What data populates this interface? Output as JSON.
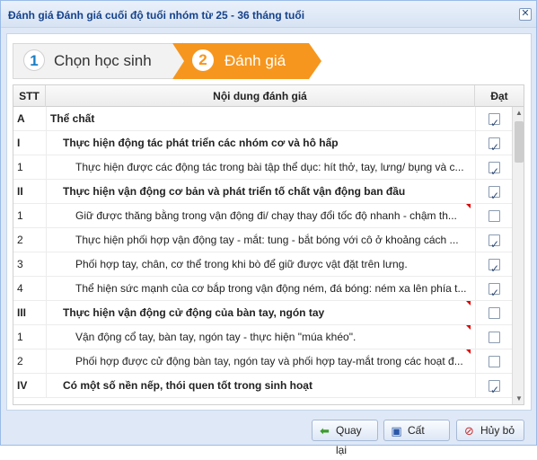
{
  "window": {
    "title": "Đánh giá Đánh giá cuối độ tuổi nhóm từ 25 - 36 tháng tuổi",
    "close_icon": "✕"
  },
  "wizard": {
    "steps": [
      {
        "number": "1",
        "label": "Chọn học sinh",
        "active": false
      },
      {
        "number": "2",
        "label": "Đánh giá",
        "active": true
      }
    ]
  },
  "grid": {
    "columns": {
      "stt": "STT",
      "content": "Nội dung đánh giá",
      "dat": "Đạt"
    },
    "rows": [
      {
        "stt": "A",
        "content": "Thể chất",
        "level": 1,
        "bold": true,
        "checked": true,
        "dirty": false
      },
      {
        "stt": "I",
        "content": "Thực hiện động tác phát triển các nhóm cơ và hô hấp",
        "level": 2,
        "bold": true,
        "checked": true,
        "dirty": false
      },
      {
        "stt": "1",
        "content": "Thực hiện được các động tác trong bài tập thể dục: hít thở, tay, lưng/ bụng và c...",
        "level": 3,
        "bold": false,
        "checked": true,
        "dirty": false
      },
      {
        "stt": "II",
        "content": "Thực hiện vận động cơ bản và phát triển tố chất vận động ban đầu",
        "level": 2,
        "bold": true,
        "checked": true,
        "dirty": false
      },
      {
        "stt": "1",
        "content": "Giữ được thăng bằng trong vận động đi/ chạy thay đổi tốc độ nhanh - chậm th...",
        "level": 3,
        "bold": false,
        "checked": false,
        "dirty": true
      },
      {
        "stt": "2",
        "content": "Thực hiện phối hợp vận động tay - mắt: tung - bắt bóng với cô ở khoảng cách ...",
        "level": 3,
        "bold": false,
        "checked": true,
        "dirty": false
      },
      {
        "stt": "3",
        "content": "Phối hợp tay, chân, cơ thể trong khi bò để giữ được vật đặt trên lưng.",
        "level": 3,
        "bold": false,
        "checked": true,
        "dirty": false
      },
      {
        "stt": "4",
        "content": "Thể hiện sức mạnh của cơ bắp trong vận động ném, đá bóng: ném xa lên phía t...",
        "level": 3,
        "bold": false,
        "checked": true,
        "dirty": false
      },
      {
        "stt": "III",
        "content": "Thực hiện vận động cử động của bàn tay, ngón tay",
        "level": 2,
        "bold": true,
        "checked": false,
        "dirty": true
      },
      {
        "stt": "1",
        "content": "Vận động cổ tay, bàn tay, ngón tay - thực hiện \"múa khéo\".",
        "level": 3,
        "bold": false,
        "checked": false,
        "dirty": true
      },
      {
        "stt": "2",
        "content": "Phối hợp được cử động bàn tay, ngón tay và phối hợp tay-mắt trong các hoạt đ...",
        "level": 3,
        "bold": false,
        "checked": false,
        "dirty": true
      },
      {
        "stt": "IV",
        "content": "Có một số nền nếp, thói quen tốt trong sinh hoạt",
        "level": 2,
        "bold": true,
        "checked": true,
        "dirty": false
      }
    ]
  },
  "buttons": {
    "back": "Quay lại",
    "save": "Cất",
    "cancel": "Hủy bỏ"
  },
  "icons": {
    "back": "arrow-left-icon",
    "save": "floppy-disk-icon",
    "cancel": "cancel-circle-icon"
  },
  "colors": {
    "active_step": "#f6961e",
    "step_number": "#1c7fc3",
    "title": "#15428b"
  }
}
